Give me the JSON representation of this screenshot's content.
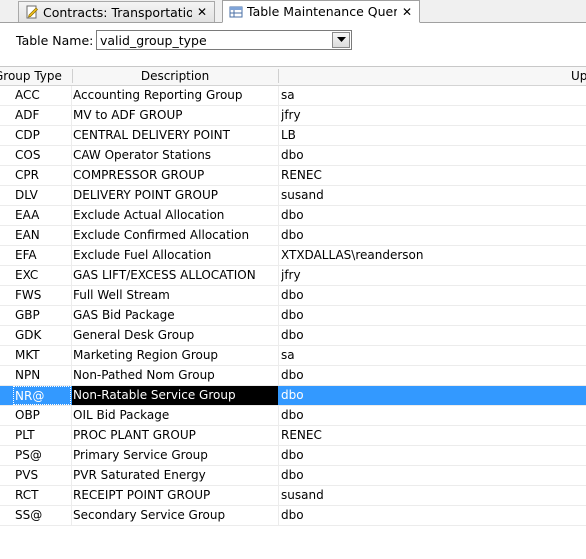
{
  "tabs": [
    {
      "label": "Contracts: Transportation",
      "icon": "edit-document-icon",
      "close": "✕"
    },
    {
      "label": "Table Maintenance Query",
      "icon": "table-icon",
      "close": "✕"
    }
  ],
  "filter": {
    "label": "Table Name:",
    "value": "valid_group_type"
  },
  "grid": {
    "columns": [
      "Group Type",
      "Description",
      "",
      "Up"
    ],
    "selected_row": 15,
    "rows": [
      {
        "code": "ACC",
        "description": "Accounting Reporting Group",
        "user": "sa"
      },
      {
        "code": "ADF",
        "description": "MV to ADF GROUP",
        "user": "jfry"
      },
      {
        "code": "CDP",
        "description": "CENTRAL DELIVERY POINT",
        "user": "LB"
      },
      {
        "code": "COS",
        "description": "CAW Operator Stations",
        "user": "dbo"
      },
      {
        "code": "CPR",
        "description": "COMPRESSOR GROUP",
        "user": "RENEC"
      },
      {
        "code": "DLV",
        "description": "DELIVERY POINT GROUP",
        "user": "susand"
      },
      {
        "code": "EAA",
        "description": "Exclude Actual Allocation",
        "user": "dbo"
      },
      {
        "code": "EAN",
        "description": "Exclude Confirmed Allocation",
        "user": "dbo"
      },
      {
        "code": "EFA",
        "description": "Exclude Fuel Allocation",
        "user": "XTXDALLAS\\reanderson"
      },
      {
        "code": "EXC",
        "description": "GAS LIFT/EXCESS ALLOCATION",
        "user": "jfry"
      },
      {
        "code": "FWS",
        "description": "Full Well Stream",
        "user": "dbo"
      },
      {
        "code": "GBP",
        "description": "GAS Bid Package",
        "user": "dbo"
      },
      {
        "code": "GDK",
        "description": "General Desk Group",
        "user": "dbo"
      },
      {
        "code": "MKT",
        "description": "Marketing Region Group",
        "user": "sa"
      },
      {
        "code": "NPN",
        "description": "Non-Pathed Nom Group",
        "user": "dbo"
      },
      {
        "code": "NR@",
        "description": "Non-Ratable Service Group",
        "user": "dbo"
      },
      {
        "code": "OBP",
        "description": "OIL Bid Package",
        "user": "dbo"
      },
      {
        "code": "PLT",
        "description": "PROC PLANT GROUP",
        "user": "RENEC"
      },
      {
        "code": "PS@",
        "description": "Primary Service Group",
        "user": "dbo"
      },
      {
        "code": "PVS",
        "description": "PVR Saturated Energy",
        "user": "dbo"
      },
      {
        "code": "RCT",
        "description": "RECEIPT POINT GROUP",
        "user": "susand"
      },
      {
        "code": "SS@",
        "description": "Secondary Service Group",
        "user": "dbo"
      }
    ]
  },
  "colors": {
    "selection": "#3399ff",
    "selected_cell": "#000000"
  }
}
